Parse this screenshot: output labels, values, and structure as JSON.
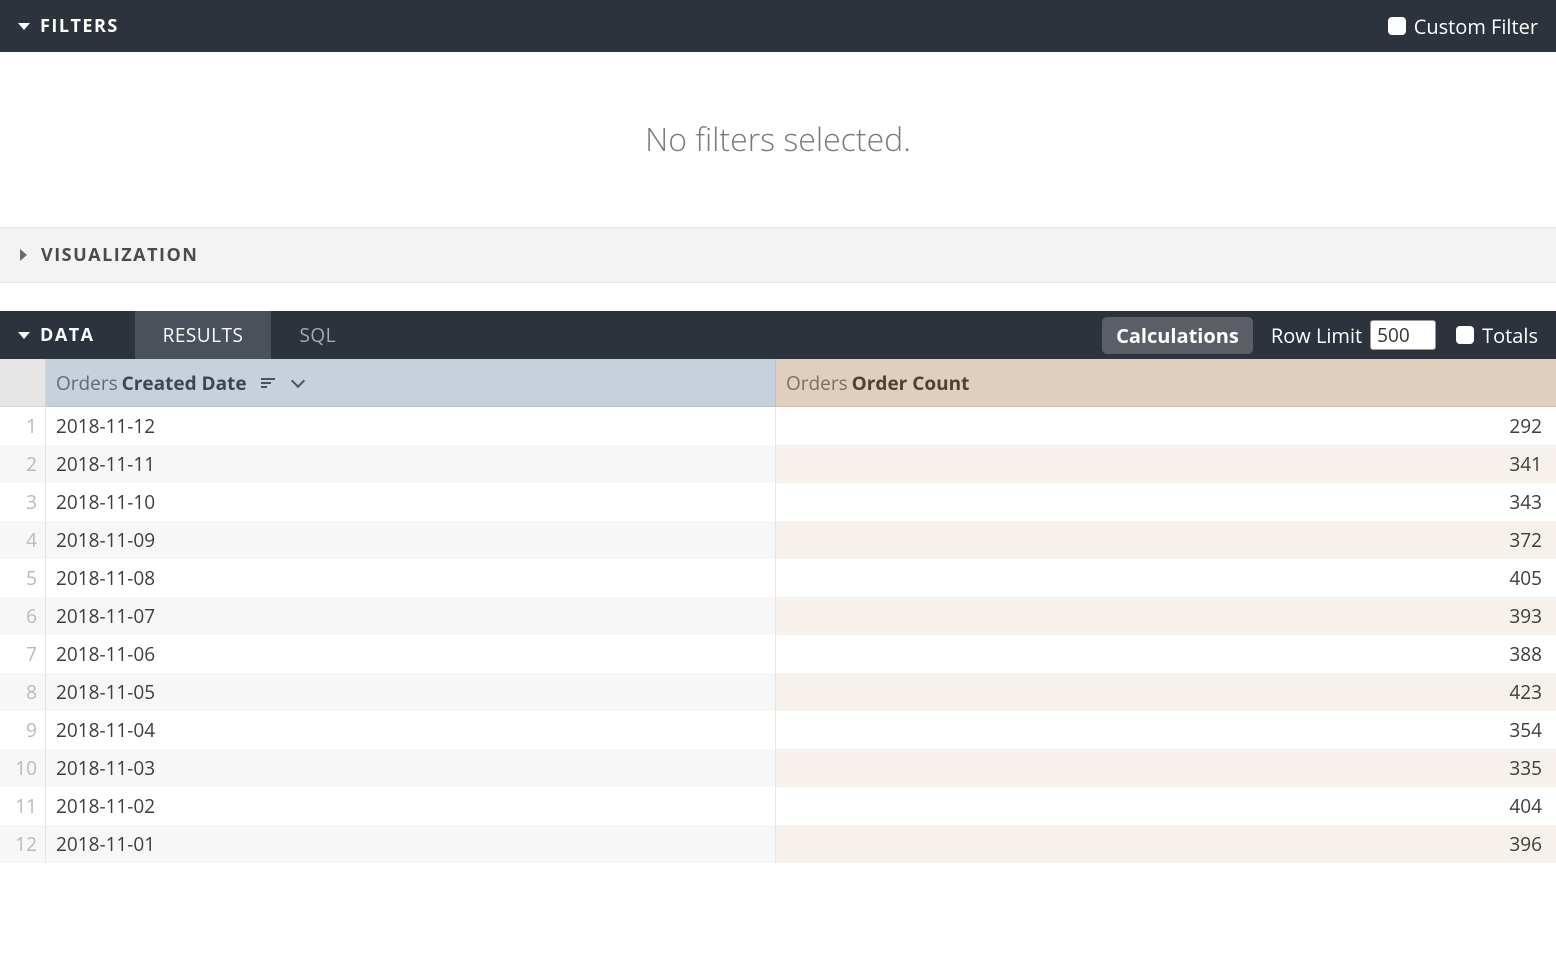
{
  "filters": {
    "title": "FILTERS",
    "custom_filter_label": "Custom Filter",
    "empty_message": "No filters selected."
  },
  "visualization": {
    "title": "VISUALIZATION"
  },
  "data": {
    "title": "DATA",
    "tabs": {
      "results": "RESULTS",
      "sql": "SQL"
    },
    "calculations_label": "Calculations",
    "row_limit_label": "Row Limit",
    "row_limit_value": "500",
    "totals_label": "Totals"
  },
  "table": {
    "dim_prefix": "Orders",
    "dim_name": "Created Date",
    "meas_prefix": "Orders",
    "meas_name": "Order Count",
    "rows": [
      {
        "n": "1",
        "date": "2018-11-12",
        "count": "292"
      },
      {
        "n": "2",
        "date": "2018-11-11",
        "count": "341"
      },
      {
        "n": "3",
        "date": "2018-11-10",
        "count": "343"
      },
      {
        "n": "4",
        "date": "2018-11-09",
        "count": "372"
      },
      {
        "n": "5",
        "date": "2018-11-08",
        "count": "405"
      },
      {
        "n": "6",
        "date": "2018-11-07",
        "count": "393"
      },
      {
        "n": "7",
        "date": "2018-11-06",
        "count": "388"
      },
      {
        "n": "8",
        "date": "2018-11-05",
        "count": "423"
      },
      {
        "n": "9",
        "date": "2018-11-04",
        "count": "354"
      },
      {
        "n": "10",
        "date": "2018-11-03",
        "count": "335"
      },
      {
        "n": "11",
        "date": "2018-11-02",
        "count": "404"
      },
      {
        "n": "12",
        "date": "2018-11-01",
        "count": "396"
      }
    ]
  }
}
